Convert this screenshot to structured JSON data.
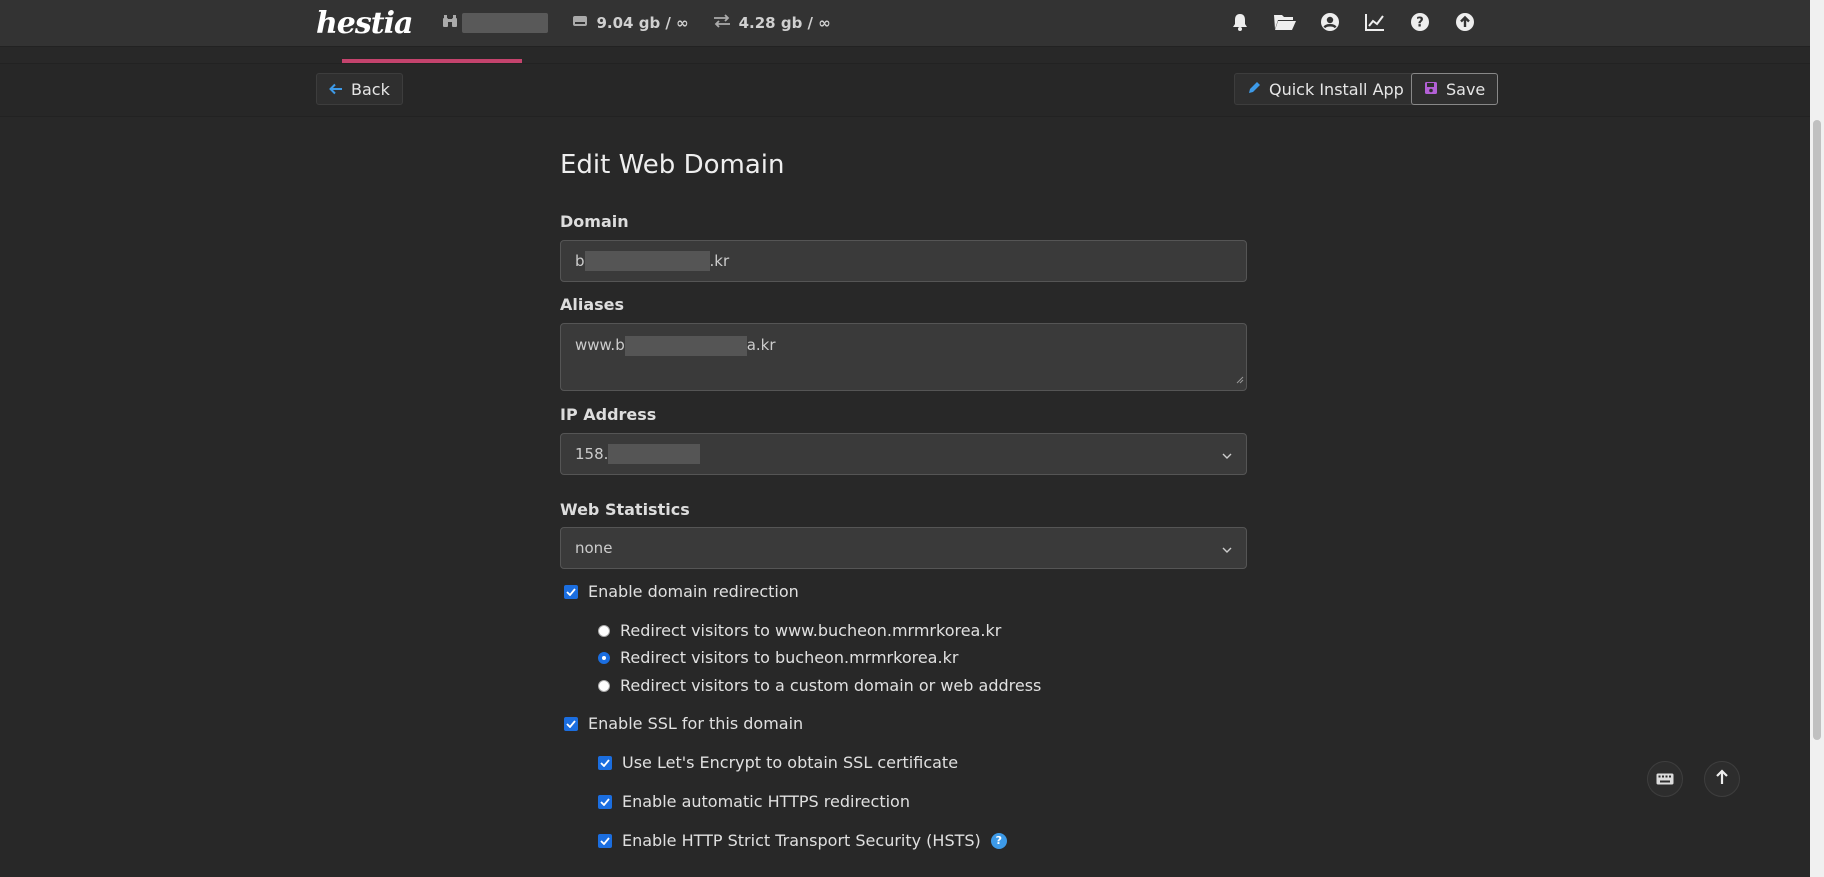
{
  "topbar": {
    "logo": "hestia",
    "disk_usage": "9.04 gb / ∞",
    "bandwidth_usage": "4.28 gb / ∞",
    "icons": [
      "bell-icon",
      "folder-icon",
      "user-circle-icon",
      "chart-line-icon",
      "question-circle-icon",
      "arrow-circle-up-icon"
    ]
  },
  "toolbar": {
    "back_label": "Back",
    "quick_install_label": "Quick Install App",
    "save_label": "Save"
  },
  "form": {
    "title": "Edit Web Domain",
    "domain_label": "Domain",
    "domain_prefix": "b",
    "domain_suffix": ".kr",
    "aliases_label": "Aliases",
    "aliases_prefix": "www.b",
    "aliases_suffix": "a.kr",
    "ip_label": "IP Address",
    "ip_prefix": "158.",
    "stats_label": "Web Statistics",
    "stats_value": "none",
    "redirect_enable": "Enable domain redirection",
    "redirect_options": [
      "Redirect visitors to www.bucheon.mrmrkorea.kr",
      "Redirect visitors to bucheon.mrmrkorea.kr",
      "Redirect visitors to a custom domain or web address"
    ],
    "redirect_selected_index": 1,
    "ssl_enable": "Enable SSL for this domain",
    "letsencrypt": "Use Let's Encrypt to obtain SSL certificate",
    "https_redirect": "Enable automatic HTTPS redirection",
    "hsts": "Enable HTTP Strict Transport Security (HSTS)",
    "help_glyph": "?"
  },
  "colors": {
    "accent": "#1b6ee0",
    "active_tab": "#c4436d",
    "background": "#282828"
  }
}
